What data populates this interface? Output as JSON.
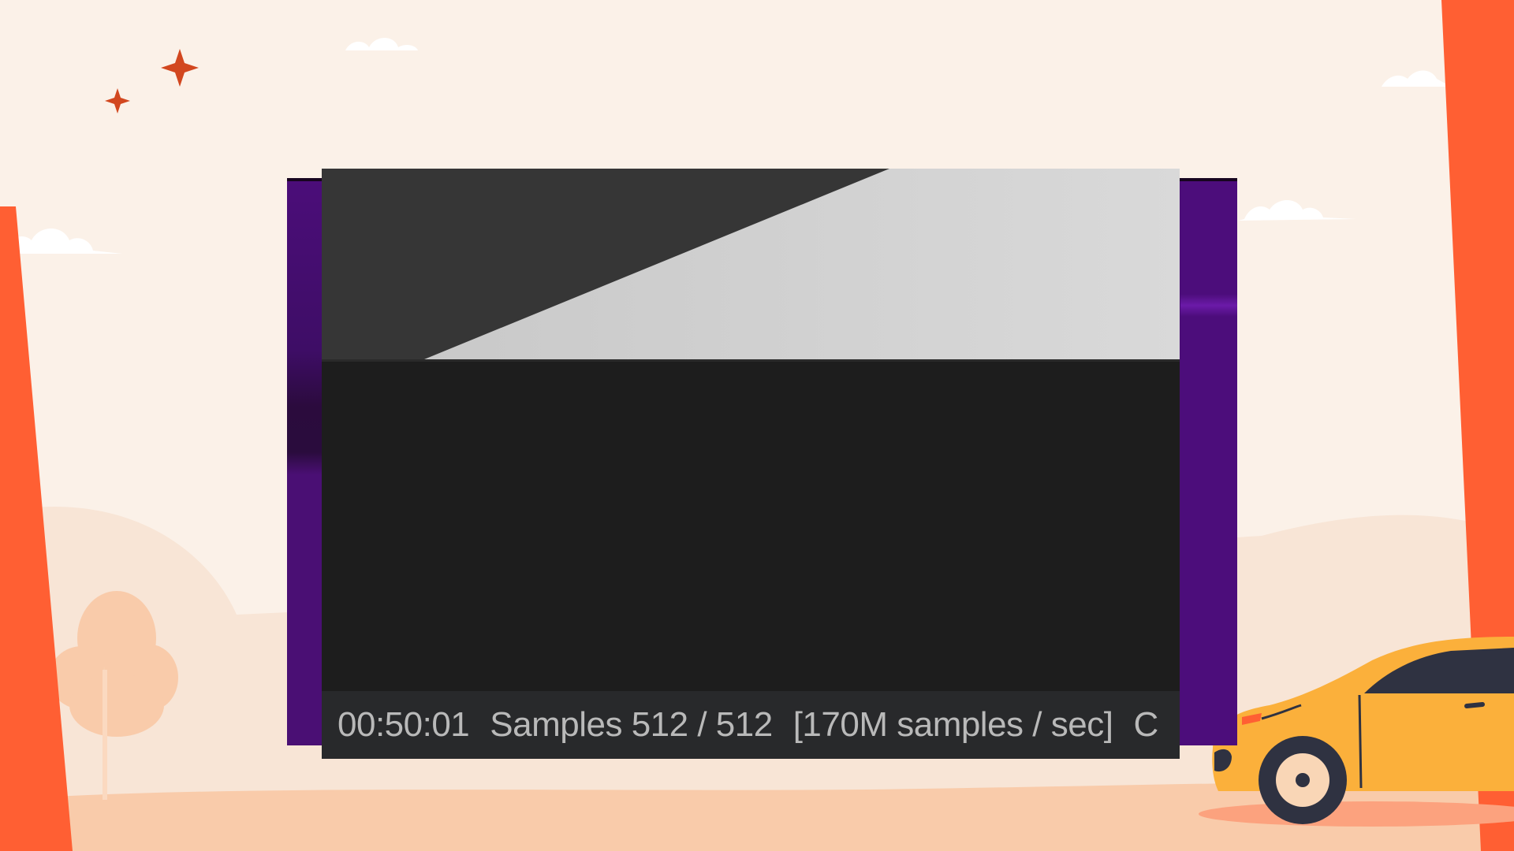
{
  "status": {
    "elapsed_time": "00:50:01",
    "samples": "Samples 512 / 512",
    "rate": "[170M samples / sec]",
    "trailing": "C"
  },
  "colors": {
    "background": "#fbf1e8",
    "accent_orange": "#ff5f33",
    "purple_window": "#4a0f74",
    "viewer_bg": "#1d1d1d",
    "status_bar_bg": "#28292b",
    "status_text": "#b9b9b9",
    "car_yellow": "#fbb03b"
  },
  "icons": [
    "sparkle-icon",
    "cloud-icon",
    "tree-icon",
    "car-icon"
  ]
}
